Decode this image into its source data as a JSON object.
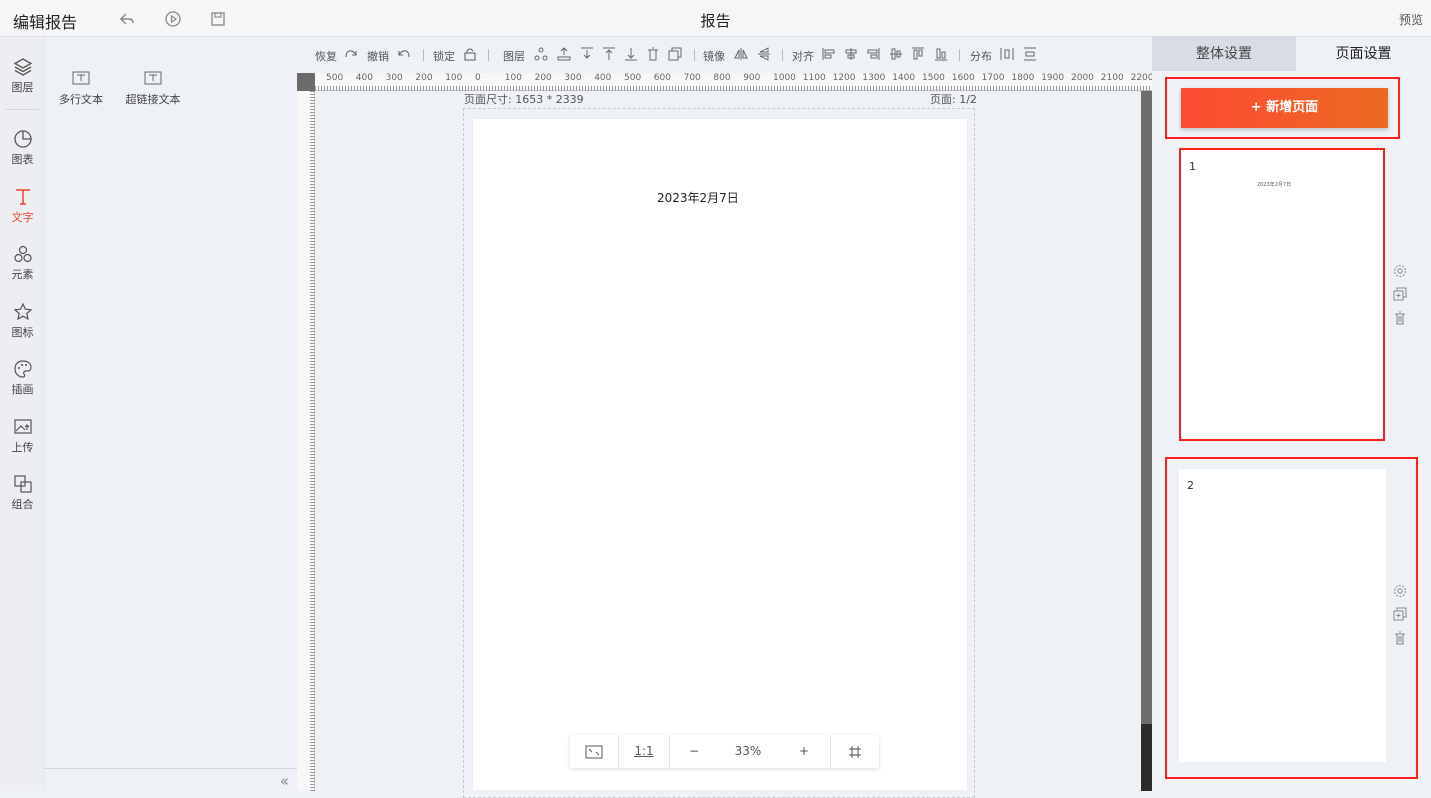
{
  "topbar": {
    "app_title": "编辑报告",
    "doc_title": "报告",
    "preview_label": "预览"
  },
  "leftnav": [
    {
      "label": "图层",
      "icon": "layers-icon"
    },
    {
      "label": "图表",
      "icon": "chart-icon"
    },
    {
      "label": "文字",
      "icon": "text-icon",
      "active": true
    },
    {
      "label": "元素",
      "icon": "elements-icon"
    },
    {
      "label": "图标",
      "icon": "star-icon"
    },
    {
      "label": "插画",
      "icon": "palette-icon"
    },
    {
      "label": "上传",
      "icon": "upload-image-icon"
    },
    {
      "label": "组合",
      "icon": "group-icon"
    }
  ],
  "panel": {
    "items": [
      {
        "label": "多行文本"
      },
      {
        "label": "超链接文本"
      }
    ]
  },
  "toolbar": {
    "redo": "恢复",
    "undo": "撤销",
    "lock": "锁定",
    "layer": "图层",
    "mirror": "镜像",
    "align": "对齐",
    "distribute": "分布"
  },
  "ruler": {
    "h_labels": [
      "500",
      "400",
      "300",
      "200",
      "100",
      "0",
      "100",
      "200",
      "300",
      "400",
      "500",
      "600",
      "700",
      "800",
      "900",
      "1000",
      "1100",
      "1200",
      "1300",
      "1400",
      "1500",
      "1600",
      "1700",
      "1800",
      "1900",
      "2000",
      "2100",
      "2200"
    ]
  },
  "canvas": {
    "page_size": "页面尺寸: 1653 * 2339",
    "page_num": "页面: 1/2",
    "page_text": "2023年2月7日"
  },
  "zoom": {
    "ratio_label": "1:1",
    "minus": "−",
    "value": "33%",
    "plus": "+"
  },
  "right": {
    "tab_global": "整体设置",
    "tab_page": "页面设置",
    "add_page": "+ 新增页面",
    "thumbs": [
      {
        "num": "1",
        "text": "2023年2月7日"
      },
      {
        "num": "2",
        "text": ""
      }
    ]
  },
  "colors": {
    "accent": "#e84432",
    "button_start": "#fd4a33",
    "button_end": "#ec6a22",
    "highlight_border": "#ff1f1f"
  }
}
